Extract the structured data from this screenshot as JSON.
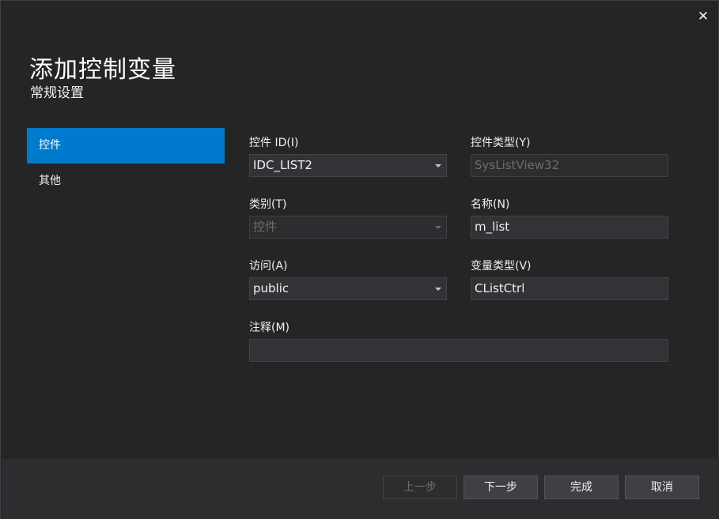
{
  "window": {
    "close_glyph": "✕"
  },
  "header": {
    "title": "添加控制变量",
    "subtitle": "常规设置"
  },
  "sidebar": {
    "items": [
      {
        "label": "控件",
        "active": true
      },
      {
        "label": "其他",
        "active": false
      }
    ]
  },
  "form": {
    "control_id": {
      "label": "控件 ID(I)",
      "value": "IDC_LIST2"
    },
    "control_type": {
      "label": "控件类型(Y)",
      "value": "SysListView32"
    },
    "category": {
      "label": "类别(T)",
      "value": "控件"
    },
    "name": {
      "label": "名称(N)",
      "value": "m_list"
    },
    "access": {
      "label": "访问(A)",
      "value": "public"
    },
    "variable_type": {
      "label": "变量类型(V)",
      "value": "CListCtrl"
    },
    "comment": {
      "label": "注释(M)",
      "value": ""
    }
  },
  "footer": {
    "prev_label": "上一步",
    "next_label": "下一步",
    "finish_label": "完成",
    "cancel_label": "取消"
  },
  "colors": {
    "accent": "#007acc",
    "background": "#252526",
    "footer": "#2d2d30"
  }
}
